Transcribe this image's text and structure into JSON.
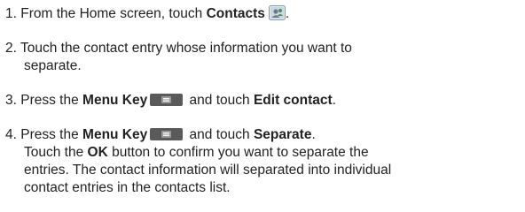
{
  "steps": [
    {
      "num": "1.",
      "text_a": "From the Home screen, touch ",
      "bold_a": "Contacts",
      "text_b": ".",
      "icon": "contacts-app-icon"
    },
    {
      "num": "2.",
      "line1": "Touch the contact entry whose information you want to",
      "line2": "separate."
    },
    {
      "num": "3.",
      "text_a": "Press the ",
      "bold_a": "Menu Key",
      "text_b": " and touch ",
      "bold_b": "Edit contact",
      "text_c": ".",
      "icon": "menu-key-icon"
    },
    {
      "num": "4.",
      "text_a": "Press the ",
      "bold_a": "Menu Key",
      "text_b": " and touch ",
      "bold_b": "Separate",
      "text_c": ".",
      "icon": "menu-key-icon",
      "detail_a": "Touch the ",
      "detail_bold": "OK",
      "detail_b": " button to confirm you want to separate the",
      "detail_line2": "entries. The contact information will separated into individual",
      "detail_line3": "contact entries in the contacts list."
    }
  ],
  "colors": {
    "text": "#222222",
    "key": "#5a5a5a"
  }
}
